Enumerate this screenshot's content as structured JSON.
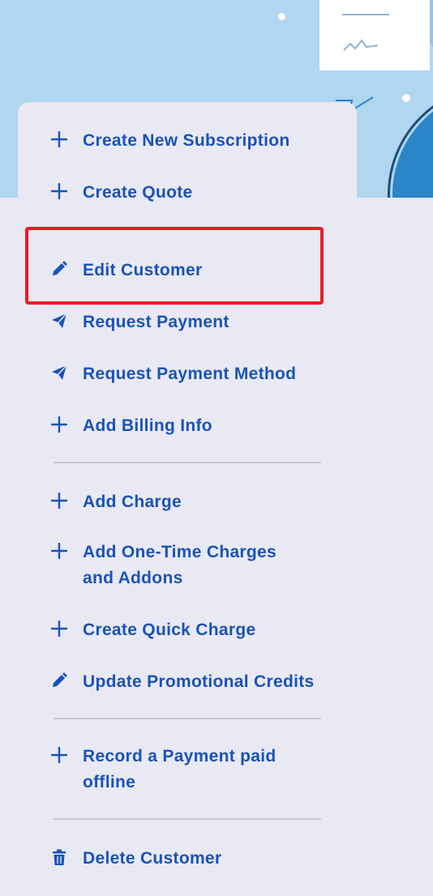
{
  "menu": {
    "items": [
      {
        "label": "Create New Subscription",
        "icon": "plus-icon"
      },
      {
        "label": "Create Quote",
        "icon": "plus-icon"
      },
      {
        "label": "Edit Customer",
        "icon": "pencil-icon"
      },
      {
        "label": "Request Payment",
        "icon": "paper-plane-icon"
      },
      {
        "label": "Request Payment Method",
        "icon": "paper-plane-icon"
      },
      {
        "label": "Add Billing Info",
        "icon": "plus-icon"
      },
      {
        "label": "Add Charge",
        "icon": "plus-icon"
      },
      {
        "label": "Add One-Time Charges and Addons",
        "icon": "plus-icon"
      },
      {
        "label": "Create Quick Charge",
        "icon": "plus-icon"
      },
      {
        "label": "Update Promotional Credits",
        "icon": "pencil-icon"
      },
      {
        "label": "Record a Payment paid offline",
        "icon": "plus-icon"
      },
      {
        "label": "Delete Customer",
        "icon": "trash-icon"
      }
    ]
  },
  "colors": {
    "accent": "#1a53b8",
    "highlight": "#ee1b22",
    "menu_background": "#e9e9f3",
    "banner_background": "#b0d6f0"
  }
}
